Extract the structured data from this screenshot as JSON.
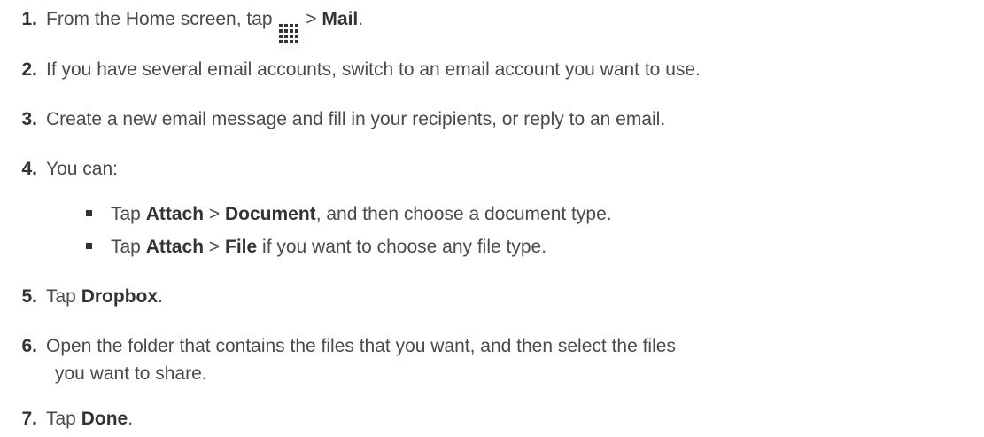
{
  "steps": [
    {
      "number": "1.",
      "parts": [
        "From the Home screen, tap",
        "",
        ">",
        "Mail",
        "."
      ],
      "icon": "apps-grid-icon"
    },
    {
      "number": "2.",
      "text": "If you have several email accounts, switch to an email account you want to use."
    },
    {
      "number": "3.",
      "text": "Create a new email message and fill in your recipients, or reply to an email."
    },
    {
      "number": "4.",
      "text": "You can:",
      "sub_items": [
        {
          "parts": [
            "Tap",
            "Attach",
            ">",
            "Document",
            ", and then choose a document type."
          ]
        },
        {
          "parts": [
            "Tap",
            "Attach",
            ">",
            "File",
            "if you want to choose any file type."
          ]
        }
      ]
    },
    {
      "number": "5.",
      "parts": [
        "Tap",
        "Dropbox",
        "."
      ]
    },
    {
      "number": "6.",
      "text": "Open the folder that contains the files that you want, and then select the files",
      "continuation": "you want to share."
    },
    {
      "number": "7.",
      "parts": [
        "Tap",
        "Done",
        "."
      ]
    }
  ]
}
